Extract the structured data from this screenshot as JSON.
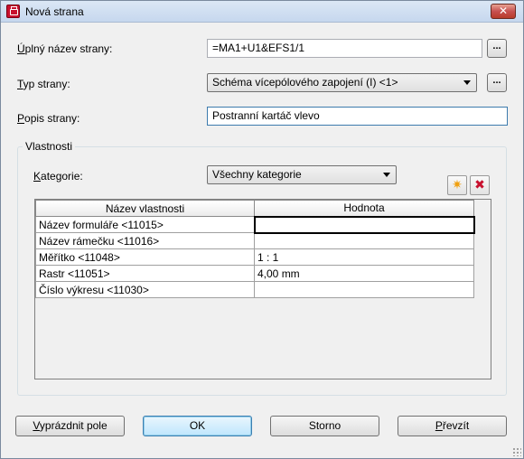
{
  "window": {
    "title": "Nová strana",
    "close_label": "✕"
  },
  "fields": {
    "full_name": {
      "label": "Úplný název strany:",
      "accel": "Ú",
      "rest": "plný název strany:",
      "value": "=MA1+U1&EFS1/1",
      "browse_label": "..."
    },
    "page_type": {
      "label": "Typ strany:",
      "accel": "T",
      "rest": "yp strany:",
      "value": "Schéma vícepólového zapojení (I) <1>",
      "browse_label": "..."
    },
    "description": {
      "label": "Popis strany:",
      "accel": "P",
      "rest": "opis strany:",
      "value": "Postranní kartáč vlevo"
    }
  },
  "properties": {
    "group_title": "Vlastnosti",
    "category_label": "Kategorie:",
    "category_accel": "K",
    "category_rest": "ategorie:",
    "category_value": "Všechny kategorie",
    "new_icon": "star-icon",
    "delete_icon": "delete-icon",
    "columns": [
      "Název vlastnosti",
      "Hodnota"
    ],
    "rows": [
      {
        "name": "Název formuláře <11015>",
        "value": ""
      },
      {
        "name": "Název rámečku <11016>",
        "value": ""
      },
      {
        "name": "Měřítko <11048>",
        "value": "1 : 1"
      },
      {
        "name": "Rastr <11051>",
        "value": "4,00 mm"
      },
      {
        "name": "Číslo výkresu <11030>",
        "value": ""
      }
    ]
  },
  "buttons": {
    "clear": {
      "label": "Vyprázdnit pole",
      "accel": "V",
      "rest": "yprázdnit pole"
    },
    "ok": "OK",
    "cancel": "Storno",
    "apply": {
      "label": "Převzít",
      "accel": "P",
      "rest": "řevzít"
    }
  }
}
